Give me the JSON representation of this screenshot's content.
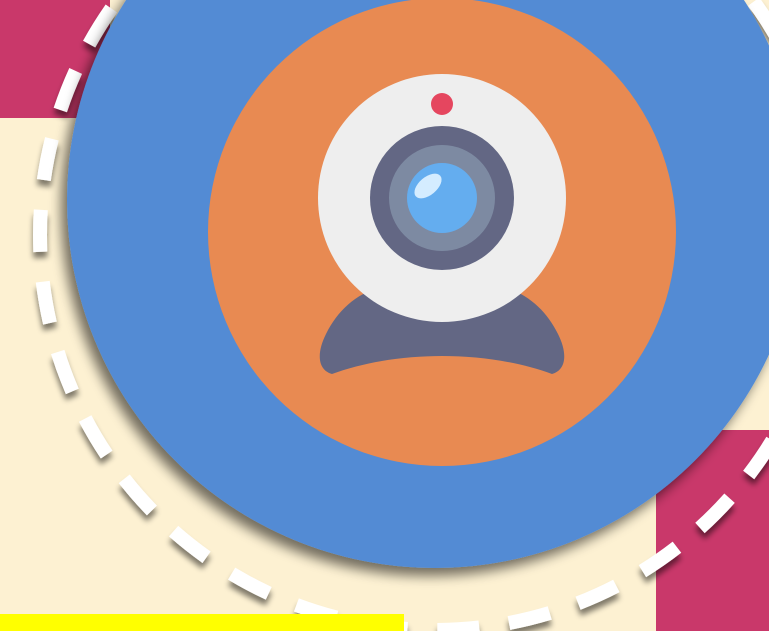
{
  "illustration": {
    "subject": "webcam-icon",
    "colors": {
      "background": "#fdf1d2",
      "accent_magenta": "#c9386a",
      "outer_circle": "#538bd4",
      "inner_circle": "#e88a52",
      "camera_body": "#eeeeee",
      "camera_stand": "#636784",
      "lens_outer": "#636784",
      "lens_ring": "#7d8aa2",
      "lens_glass": "#64adef",
      "indicator_light": "#e5465f",
      "dashed_ring": "#ffffff",
      "highlight_bar": "#ffff00"
    }
  }
}
